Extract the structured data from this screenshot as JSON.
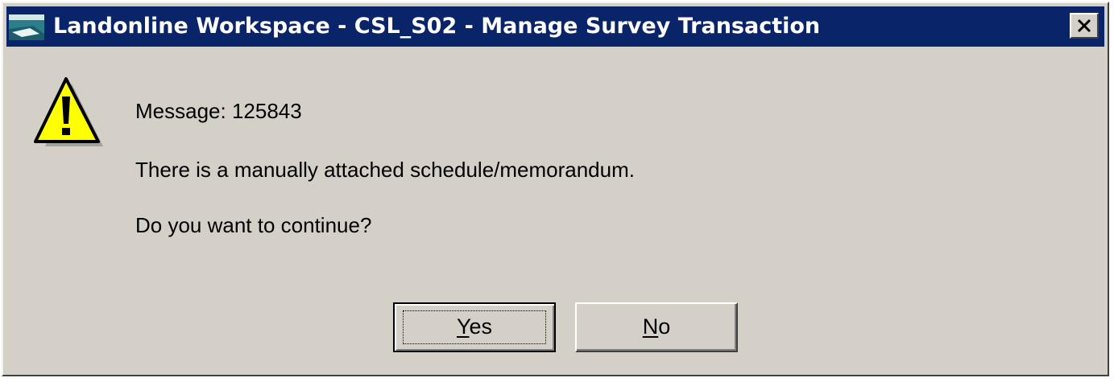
{
  "window": {
    "title": "Landonline Workspace - CSL_S02 - Manage Survey Transaction",
    "app_icon": "landonline-app-icon",
    "close_icon": "close-icon",
    "title_bar_color": "#0a246a",
    "background_color": "#d4d0c8"
  },
  "dialog": {
    "icon": "warning-icon",
    "message_id": "Message: 125843",
    "message": "There is a manually attached schedule/memorandum.",
    "question": "Do you want to continue?"
  },
  "buttons": {
    "yes": {
      "mnemonic": "Y",
      "rest": "es"
    },
    "no": {
      "mnemonic": "N",
      "rest": "o"
    }
  }
}
